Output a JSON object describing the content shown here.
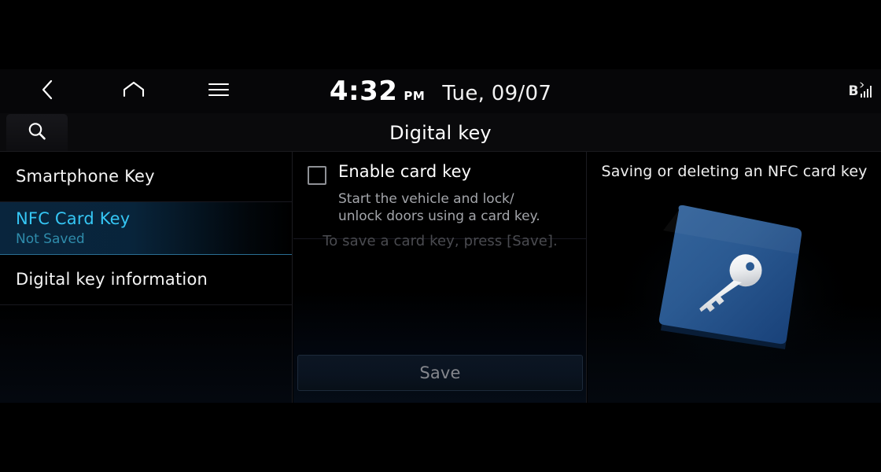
{
  "statusbar": {
    "back_icon": "chevron-left-icon",
    "home_icon": "home-icon",
    "menu_icon": "hamburger-menu-icon",
    "time": "4:32",
    "ampm": "PM",
    "date": "Tue, 09/07",
    "bluetooth_label": "B",
    "bluetooth_icon": "bluetooth-icon",
    "signal_icon": "signal-bars-icon"
  },
  "titlebar": {
    "search_icon": "search-icon",
    "title": "Digital key"
  },
  "sidebar": {
    "items": [
      {
        "label": "Smartphone Key",
        "sub": "",
        "selected": false
      },
      {
        "label": "NFC Card Key",
        "sub": "Not Saved",
        "selected": true
      },
      {
        "label": "Digital key information",
        "sub": "",
        "selected": false
      }
    ]
  },
  "main": {
    "enable_title": "Enable card key",
    "enable_desc": "Start the vehicle and lock/\nunlock doors using a card key.",
    "checkbox_checked": false,
    "save_hint": "To save a card key, press [Save].",
    "save_label": "Save"
  },
  "help": {
    "caption": "Saving or deleting an NFC card key",
    "card_icon": "nfc-card-key-icon",
    "key_icon": "key-icon"
  },
  "colors": {
    "accent_cyan": "#35c6f4",
    "accent_cyan_dim": "#2f8cab",
    "card_blue_light": "#2f5f95",
    "card_blue_dark": "#17477f",
    "text_primary": "#ffffff",
    "text_secondary": "#a3a5aa",
    "text_disabled": "#4a4b50"
  }
}
